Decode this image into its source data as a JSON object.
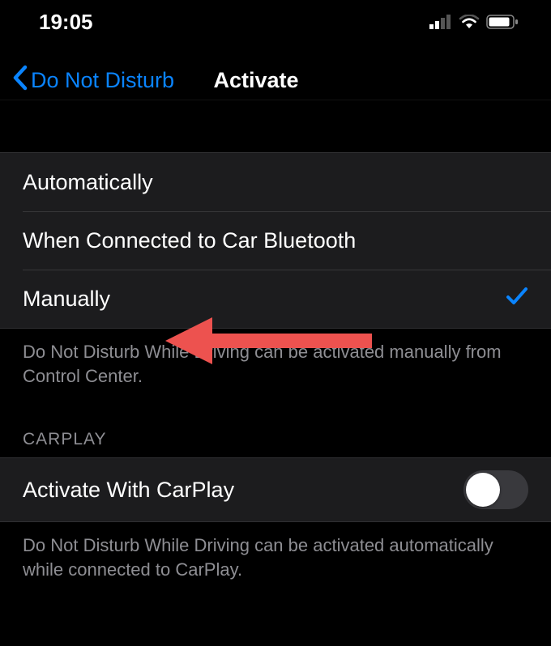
{
  "status_bar": {
    "time": "19:05"
  },
  "nav": {
    "back_label": "Do Not Disturb",
    "title": "Activate"
  },
  "activation_options": {
    "items": [
      {
        "label": "Automatically",
        "selected": false
      },
      {
        "label": "When Connected to Car Bluetooth",
        "selected": false
      },
      {
        "label": "Manually",
        "selected": true
      }
    ],
    "footer": "Do Not Disturb While Driving can be activated manually from Control Center."
  },
  "carplay": {
    "header": "CARPLAY",
    "toggle_label": "Activate With CarPlay",
    "toggle_on": false,
    "footer": "Do Not Disturb While Driving can be activated automatically while connected to CarPlay."
  },
  "colors": {
    "accent": "#0a84ff",
    "arrow": "#ed524f"
  }
}
